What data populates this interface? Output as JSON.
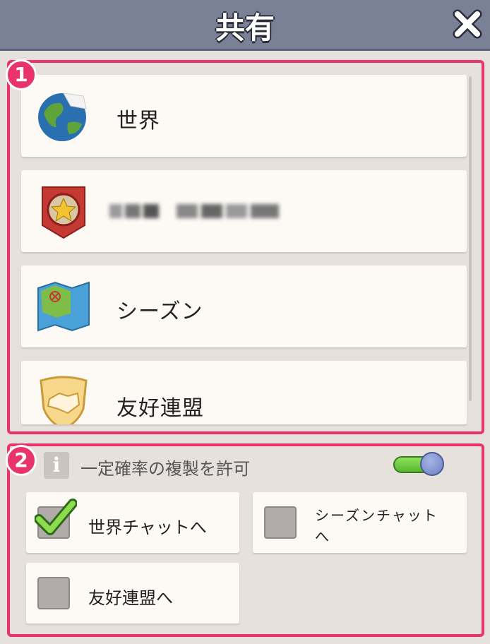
{
  "header": {
    "title": "共有"
  },
  "annotations": {
    "one": "1",
    "two": "2"
  },
  "channels": [
    {
      "label": "世界",
      "icon": "globe-icon"
    },
    {
      "label": "",
      "icon": "guild-emblem-icon",
      "blurred": true
    },
    {
      "label": "シーズン",
      "icon": "map-icon"
    },
    {
      "label": "友好連盟",
      "icon": "handshake-shield-icon"
    }
  ],
  "options": {
    "allow_copy_label": "一定確率の複製を許可",
    "allow_copy_enabled": true
  },
  "targets": [
    {
      "label": "世界チャットへ",
      "checked": true
    },
    {
      "label": "シーズンチャットへ",
      "checked": false
    },
    {
      "label": "友好連盟へ",
      "checked": false
    }
  ],
  "colors": {
    "annotation": "#e8336d",
    "header": "#7a8197",
    "toggle_on": "#55b82f"
  }
}
